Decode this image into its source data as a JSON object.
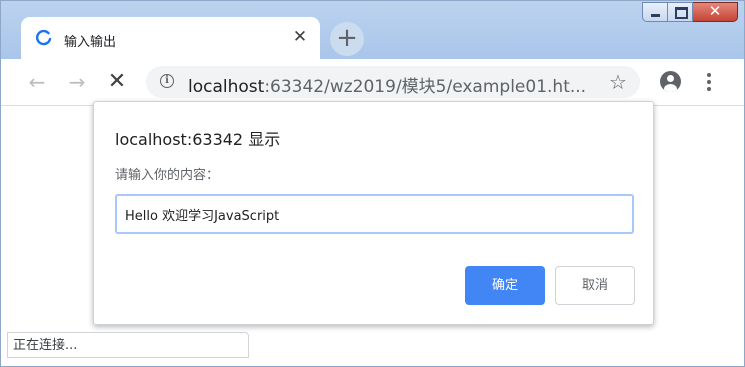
{
  "colors": {
    "accent": "#4285f4",
    "tab_strip": "#b4cdef",
    "spinner": "#1a73e8",
    "close_button": "#c34535"
  },
  "tab": {
    "title": "输入输出",
    "spinner_icon": "loading-spinner-icon",
    "close_label": "✕"
  },
  "new_tab": {
    "label": "+"
  },
  "window_controls": {
    "close_label": "✕"
  },
  "toolbar": {
    "back_label": "←",
    "forward_label": "→",
    "stop_label": "✕",
    "info_label": "i",
    "star_label": "☆"
  },
  "address": {
    "host": "localhost",
    "rest": ":63342/wz2019/模块5/example01.ht..."
  },
  "dialog": {
    "title": "localhost:63342 显示",
    "message": "请输入你的内容：",
    "input_value": "Hello 欢迎学习JavaScript",
    "ok_label": "确定",
    "cancel_label": "取消"
  },
  "status_bar": {
    "text": "正在连接..."
  }
}
